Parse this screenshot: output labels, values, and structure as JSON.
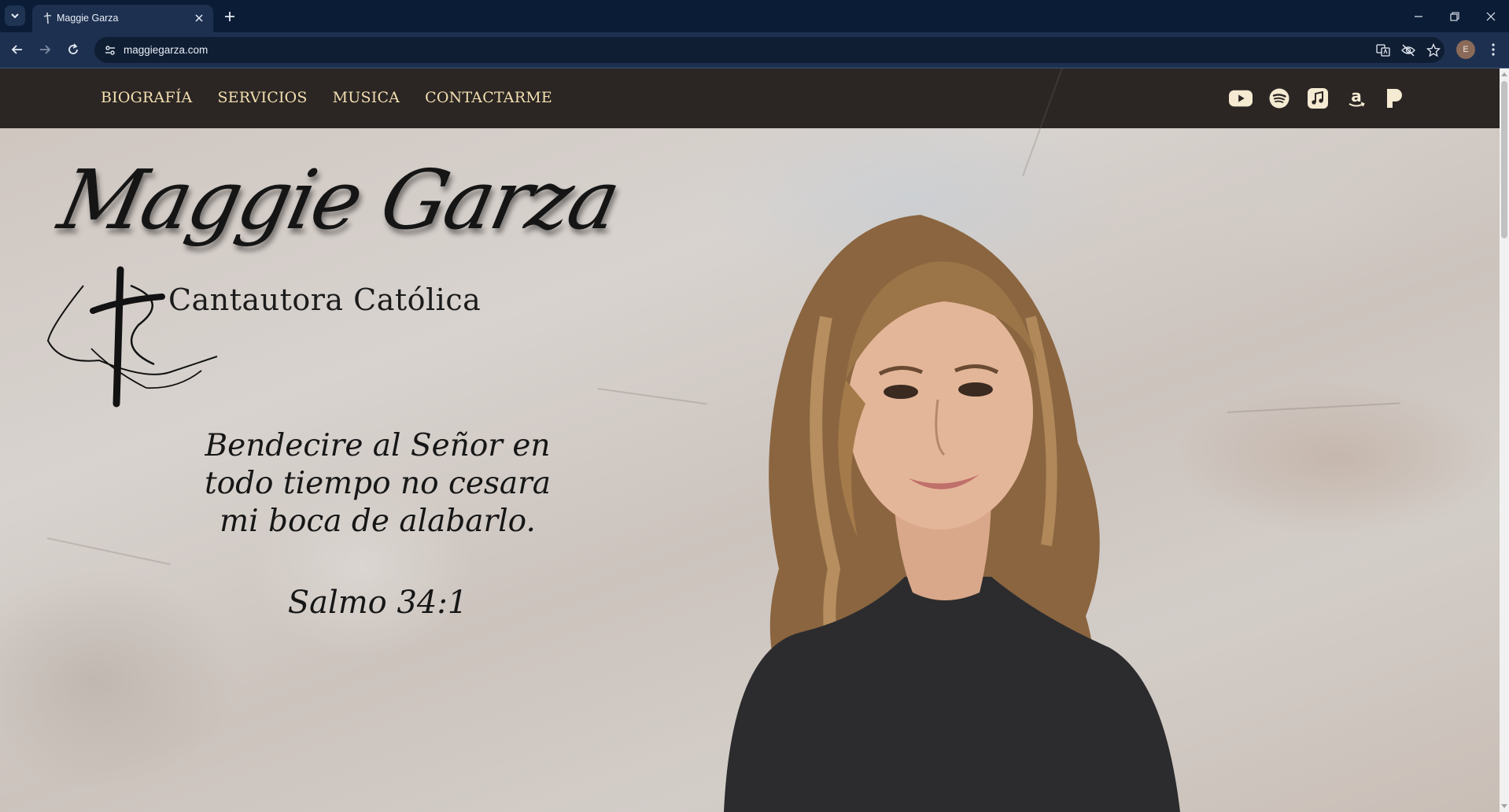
{
  "browser": {
    "tab": {
      "title": "Maggie Garza",
      "favicon": "cross-logo-icon"
    },
    "address_bar": {
      "url": "maggiegarza.com"
    },
    "profile_initial": "E",
    "toolbar_icons": [
      "translate-icon",
      "eye-slash-icon",
      "star-icon"
    ],
    "window_controls": [
      "minimize-icon",
      "restore-icon",
      "close-icon"
    ]
  },
  "site": {
    "nav": {
      "items": [
        {
          "label": "BIOGRAFÍA"
        },
        {
          "label": "SERVICIOS"
        },
        {
          "label": "MUSICA"
        },
        {
          "label": "CONTACTARME"
        }
      ]
    },
    "socials": [
      "youtube-icon",
      "spotify-icon",
      "apple-music-icon",
      "amazon-icon",
      "pandora-icon"
    ],
    "hero": {
      "name": "Maggie Garza",
      "subtitle": "Cantautora Católica",
      "verse": "Bendecire al Señor en todo tiempo no cesara mi boca de alabarlo.",
      "reference": "Salmo 34:1"
    }
  },
  "colors": {
    "chrome_tabbar": "#0b1d36",
    "chrome_toolbar": "#1e3050",
    "header_bg": "#2b2624",
    "nav_text": "#f3dfb0",
    "hero_text": "#161616"
  }
}
